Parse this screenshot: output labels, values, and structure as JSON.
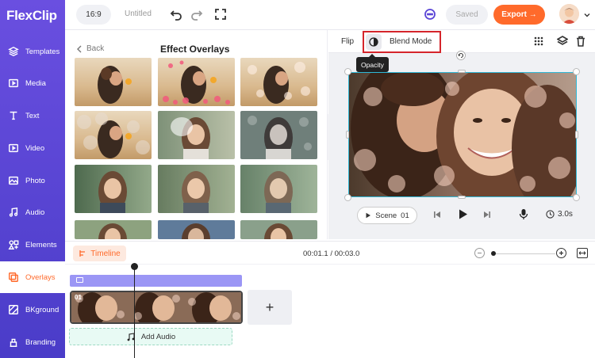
{
  "app": {
    "logo_text": "FlexClip"
  },
  "sidebar": {
    "items": [
      {
        "label": "Templates",
        "icon": "layers-icon"
      },
      {
        "label": "Media",
        "icon": "media-icon"
      },
      {
        "label": "Text",
        "icon": "text-icon"
      },
      {
        "label": "Video",
        "icon": "video-icon"
      },
      {
        "label": "Photo",
        "icon": "photo-icon"
      },
      {
        "label": "Audio",
        "icon": "music-icon"
      },
      {
        "label": "Elements",
        "icon": "elements-icon"
      },
      {
        "label": "Overlays",
        "icon": "overlays-icon",
        "active": true
      },
      {
        "label": "BKground",
        "icon": "background-icon"
      },
      {
        "label": "Branding",
        "icon": "branding-icon"
      }
    ]
  },
  "topbar": {
    "ratio": "16:9",
    "title": "Untitled",
    "saved_label": "Saved",
    "export_label": "Export →"
  },
  "panel": {
    "back_label": "Back",
    "title": "Effect Overlays"
  },
  "preview_toolbar": {
    "flip_label": "Flip",
    "blend_label": "Blend Mode",
    "tooltip": "Opacity"
  },
  "player": {
    "scene_label": "Scene",
    "scene_number": "01",
    "duration": "3.0s"
  },
  "timeline": {
    "label": "Timeline",
    "time": "00:01.1 / 00:03.0",
    "clip_number": "01",
    "add_audio_label": "Add Audio",
    "add_label": "+"
  },
  "colors": {
    "accent": "#ff6a2b",
    "sidebar": "#5a45d6",
    "selection": "#2fb8d6",
    "highlight": "#d5252b"
  }
}
